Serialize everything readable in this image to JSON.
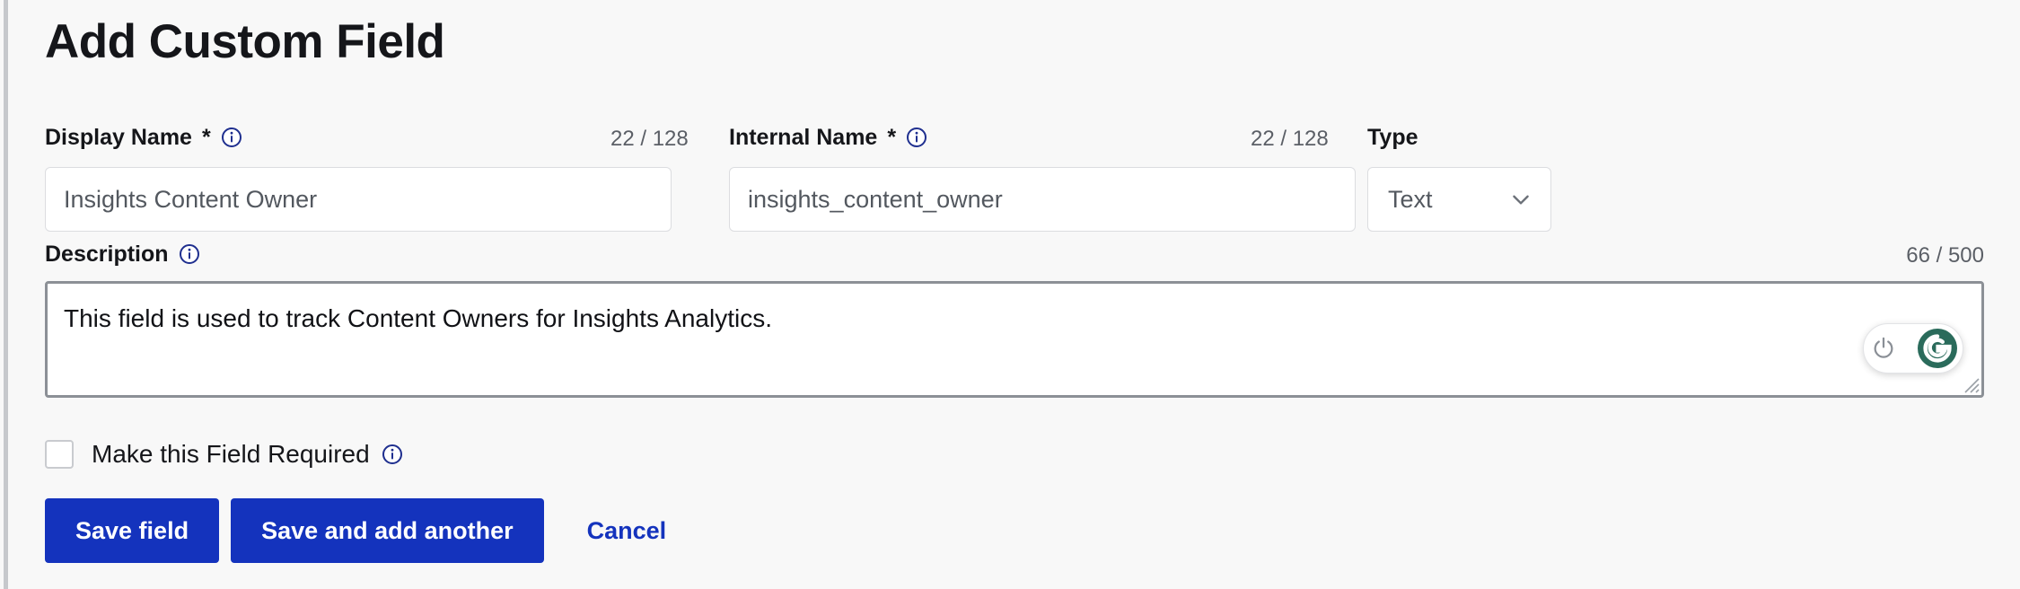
{
  "page": {
    "title": "Add Custom Field",
    "accent_blue": "#1433bd",
    "info_icon_color": "#1f2f8f",
    "background": "#f8f8f8"
  },
  "fields": {
    "display_name": {
      "label": "Display Name",
      "required_mark": "*",
      "info_icon": "info-circle-icon",
      "counter": "22 / 128",
      "value": "Insights Content Owner",
      "placeholder": "Insights Content Owner"
    },
    "internal_name": {
      "label": "Internal Name",
      "required_mark": "*",
      "info_icon": "info-circle-icon",
      "counter": "22 / 128",
      "value": "insights_content_owner",
      "placeholder": "insights_content_owner"
    },
    "type": {
      "label": "Type",
      "selected": "Text",
      "chevron_icon": "chevron-down-icon"
    },
    "description": {
      "label": "Description",
      "info_icon": "info-circle-icon",
      "counter": "66 / 500",
      "value": "This field is used to track Content Owners for Insights Analytics.",
      "resize_handle_icon": "resize-handle-icon"
    }
  },
  "grammarly": {
    "power_icon": "power-icon",
    "logo_icon": "grammarly-g-icon",
    "logo_letter": "G",
    "badge_color": "#2a6b5b"
  },
  "required_checkbox": {
    "label": "Make this Field Required",
    "checked": false,
    "info_icon": "info-circle-icon"
  },
  "actions": {
    "save": "Save field",
    "save_and_add": "Save and add another",
    "cancel": "Cancel"
  }
}
